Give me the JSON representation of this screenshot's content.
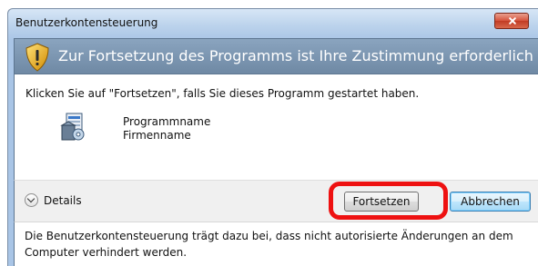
{
  "window": {
    "title": "Benutzerkontensteuerung"
  },
  "banner": {
    "text": "Zur Fortsetzung des Programms ist Ihre Zustimmung erforderlich"
  },
  "content": {
    "instruction": "Klicken Sie auf \"Fortsetzen\", falls Sie dieses Programm gestartet haben.",
    "program_name": "Programmname",
    "company_name": "Firmenname"
  },
  "footer": {
    "details_label": "Details",
    "continue_label": "Fortsetzen",
    "cancel_label": "Abbrechen"
  },
  "info": {
    "text": "Die Benutzerkontensteuerung trägt dazu bei, dass nicht autorisierte Änderungen an dem Computer verhindert werden."
  },
  "colors": {
    "highlight": "#ee1111",
    "banner": "#7a94af",
    "close": "#c9452c"
  },
  "icons": [
    "shield-warning-icon",
    "close-icon",
    "program-installer-icon",
    "chevron-down-icon"
  ]
}
